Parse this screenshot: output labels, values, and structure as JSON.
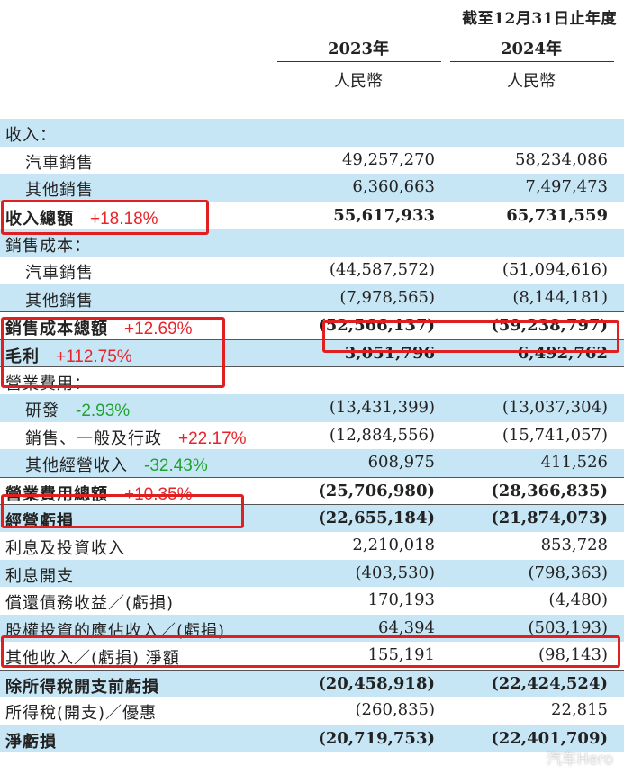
{
  "header": {
    "period_title": "截至12月31日止年度",
    "years": [
      "2023年",
      "2024年"
    ],
    "unit": "人民幣"
  },
  "rows": [
    {
      "label": "收入：",
      "v2023": "",
      "v2024": "",
      "blue": true,
      "bold": false,
      "indent": false
    },
    {
      "label": "汽車銷售",
      "v2023": "49,257,270",
      "v2024": "58,234,086",
      "blue": false,
      "indent": true
    },
    {
      "label": "其他銷售",
      "v2023": "6,360,663",
      "v2024": "7,497,473",
      "blue": true,
      "indent": true
    },
    {
      "label": "收入總額",
      "v2023": "55,617,933",
      "v2024": "65,731,559",
      "blue": false,
      "bold": true,
      "rule": true,
      "pct": "+18.18%",
      "pct_color": "red"
    },
    {
      "label": "銷售成本：",
      "v2023": "",
      "v2024": "",
      "blue": true,
      "rule": true
    },
    {
      "label": "汽車銷售",
      "v2023": "(44,587,572)",
      "v2024": "(51,094,616)",
      "blue": false,
      "indent": true
    },
    {
      "label": "其他銷售",
      "v2023": "(7,978,565)",
      "v2024": "(8,144,181)",
      "blue": true,
      "indent": true
    },
    {
      "label": "銷售成本總額",
      "v2023": "(52,566,137)",
      "v2024": "(59,238,797)",
      "blue": false,
      "bold": true,
      "rule": true,
      "pct": "+12.69%",
      "pct_color": "red"
    },
    {
      "label": "毛利",
      "v2023": "3,051,796",
      "v2024": "6,492,762",
      "blue": true,
      "bold": true,
      "rule": true,
      "pct": "+112.75%",
      "pct_color": "red"
    },
    {
      "label": "營業費用：",
      "v2023": "",
      "v2024": "",
      "blue": false,
      "rule": true
    },
    {
      "label": "研發",
      "v2023": "(13,431,399)",
      "v2024": "(13,037,304)",
      "blue": true,
      "indent": true,
      "pct": "-2.93%",
      "pct_color": "green"
    },
    {
      "label": "銷售、一般及行政",
      "v2023": "(12,884,556)",
      "v2024": "(15,741,057)",
      "blue": false,
      "indent": true,
      "pct": "+22.17%",
      "pct_color": "red"
    },
    {
      "label": "其他經營收入",
      "v2023": "608,975",
      "v2024": "411,526",
      "blue": true,
      "indent": true,
      "pct": "-32.43%",
      "pct_color": "green"
    },
    {
      "label": "營業費用總額",
      "v2023": "(25,706,980)",
      "v2024": "(28,366,835)",
      "blue": false,
      "bold": true,
      "rule": true,
      "pct": "+10.35%",
      "pct_color": "red"
    },
    {
      "label": "經營虧損",
      "v2023": "(22,655,184)",
      "v2024": "(21,874,073)",
      "blue": true,
      "bold": true,
      "rule": true
    },
    {
      "label": "利息及投資收入",
      "v2023": "2,210,018",
      "v2024": "853,728",
      "blue": false
    },
    {
      "label": "利息開支",
      "v2023": "(403,530)",
      "v2024": "(798,363)",
      "blue": true
    },
    {
      "label": "償還債務收益／(虧損)",
      "v2023": "170,193",
      "v2024": "(4,480)",
      "blue": false
    },
    {
      "label": "股權投資的應佔收入／(虧損)",
      "v2023": "64,394",
      "v2024": "(503,193)",
      "blue": true
    },
    {
      "label": "其他收入／(虧損) 淨額",
      "v2023": "155,191",
      "v2024": "(98,143)",
      "blue": false
    },
    {
      "label": "除所得稅開支前虧損",
      "v2023": "(20,458,918)",
      "v2024": "(22,424,524)",
      "blue": true,
      "bold": true,
      "rule": true
    },
    {
      "label": "所得稅(開支)／優惠",
      "v2023": "(260,835)",
      "v2024": "22,815",
      "blue": false
    },
    {
      "label": "淨虧損",
      "v2023": "(20,719,753)",
      "v2024": "(22,401,709)",
      "blue": true,
      "bold": true,
      "rule": true
    }
  ],
  "watermark": "汽车Hero",
  "colors": {
    "row_blue": "#c7e6f5",
    "highlight_box": "#e02020",
    "pct_up": "#e8242b",
    "pct_down": "#1fa32e"
  }
}
